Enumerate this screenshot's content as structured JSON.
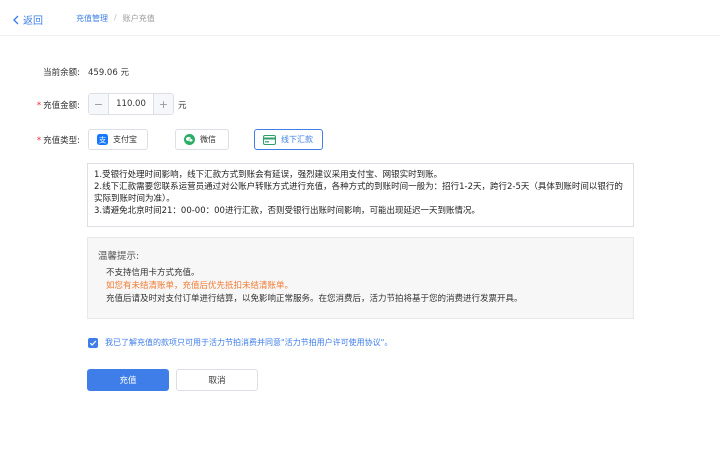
{
  "header": {
    "back_label": "返回",
    "breadcrumb_parent": "充值管理",
    "breadcrumb_separator": "/",
    "breadcrumb_current": "账户充值"
  },
  "balance": {
    "label": "当前余额:",
    "value": "459.06 元"
  },
  "amount": {
    "required_mark": "*",
    "label": "充值金额:",
    "minus": "−",
    "value": "110.00",
    "plus": "+",
    "unit": "元"
  },
  "pay_type": {
    "required_mark": "*",
    "label": "充值类型:",
    "options": [
      {
        "label": "支付宝",
        "icon": "alipay-icon",
        "selected": false
      },
      {
        "label": "微信",
        "icon": "wechat-icon",
        "selected": false
      },
      {
        "label": "线下汇款",
        "icon": "bank-card-icon",
        "selected": true
      }
    ]
  },
  "notice": {
    "lines": [
      "1.受银行处理时间影响，线下汇款方式到账会有延误，强烈建议采用支付宝、网银实时到账。",
      "2.线下汇款需要您联系运营员通过对公账户转账方式进行充值，各种方式的到账时间一般为：招行1-2天，跨行2-5天（具体到账时间以银行的实际到账时间为准）。",
      "3.请避免北京时间21：00-00：00进行汇款，否则受银行出账时间影响，可能出现延迟一天到账情况。"
    ]
  },
  "tips": {
    "title": "温馨提示:",
    "line1": "不支持信用卡方式充值。",
    "line2": "如您有未结清账单，充值后优先抵扣未结清账单。",
    "line3": "充值后请及时对支付订单进行结算，以免影响正常服务。在您消费后，活力节拍将基于您的消费进行发票开具。"
  },
  "agreement": {
    "checked": true,
    "text": "我已了解充值的款项只可用于活力节拍消费并同意\"活力节拍用户许可使用协议\"。"
  },
  "actions": {
    "submit_label": "充值",
    "cancel_label": "取消"
  },
  "colors": {
    "accent": "#3f7ee8",
    "warning": "#f07b33",
    "required": "#f5222d"
  }
}
